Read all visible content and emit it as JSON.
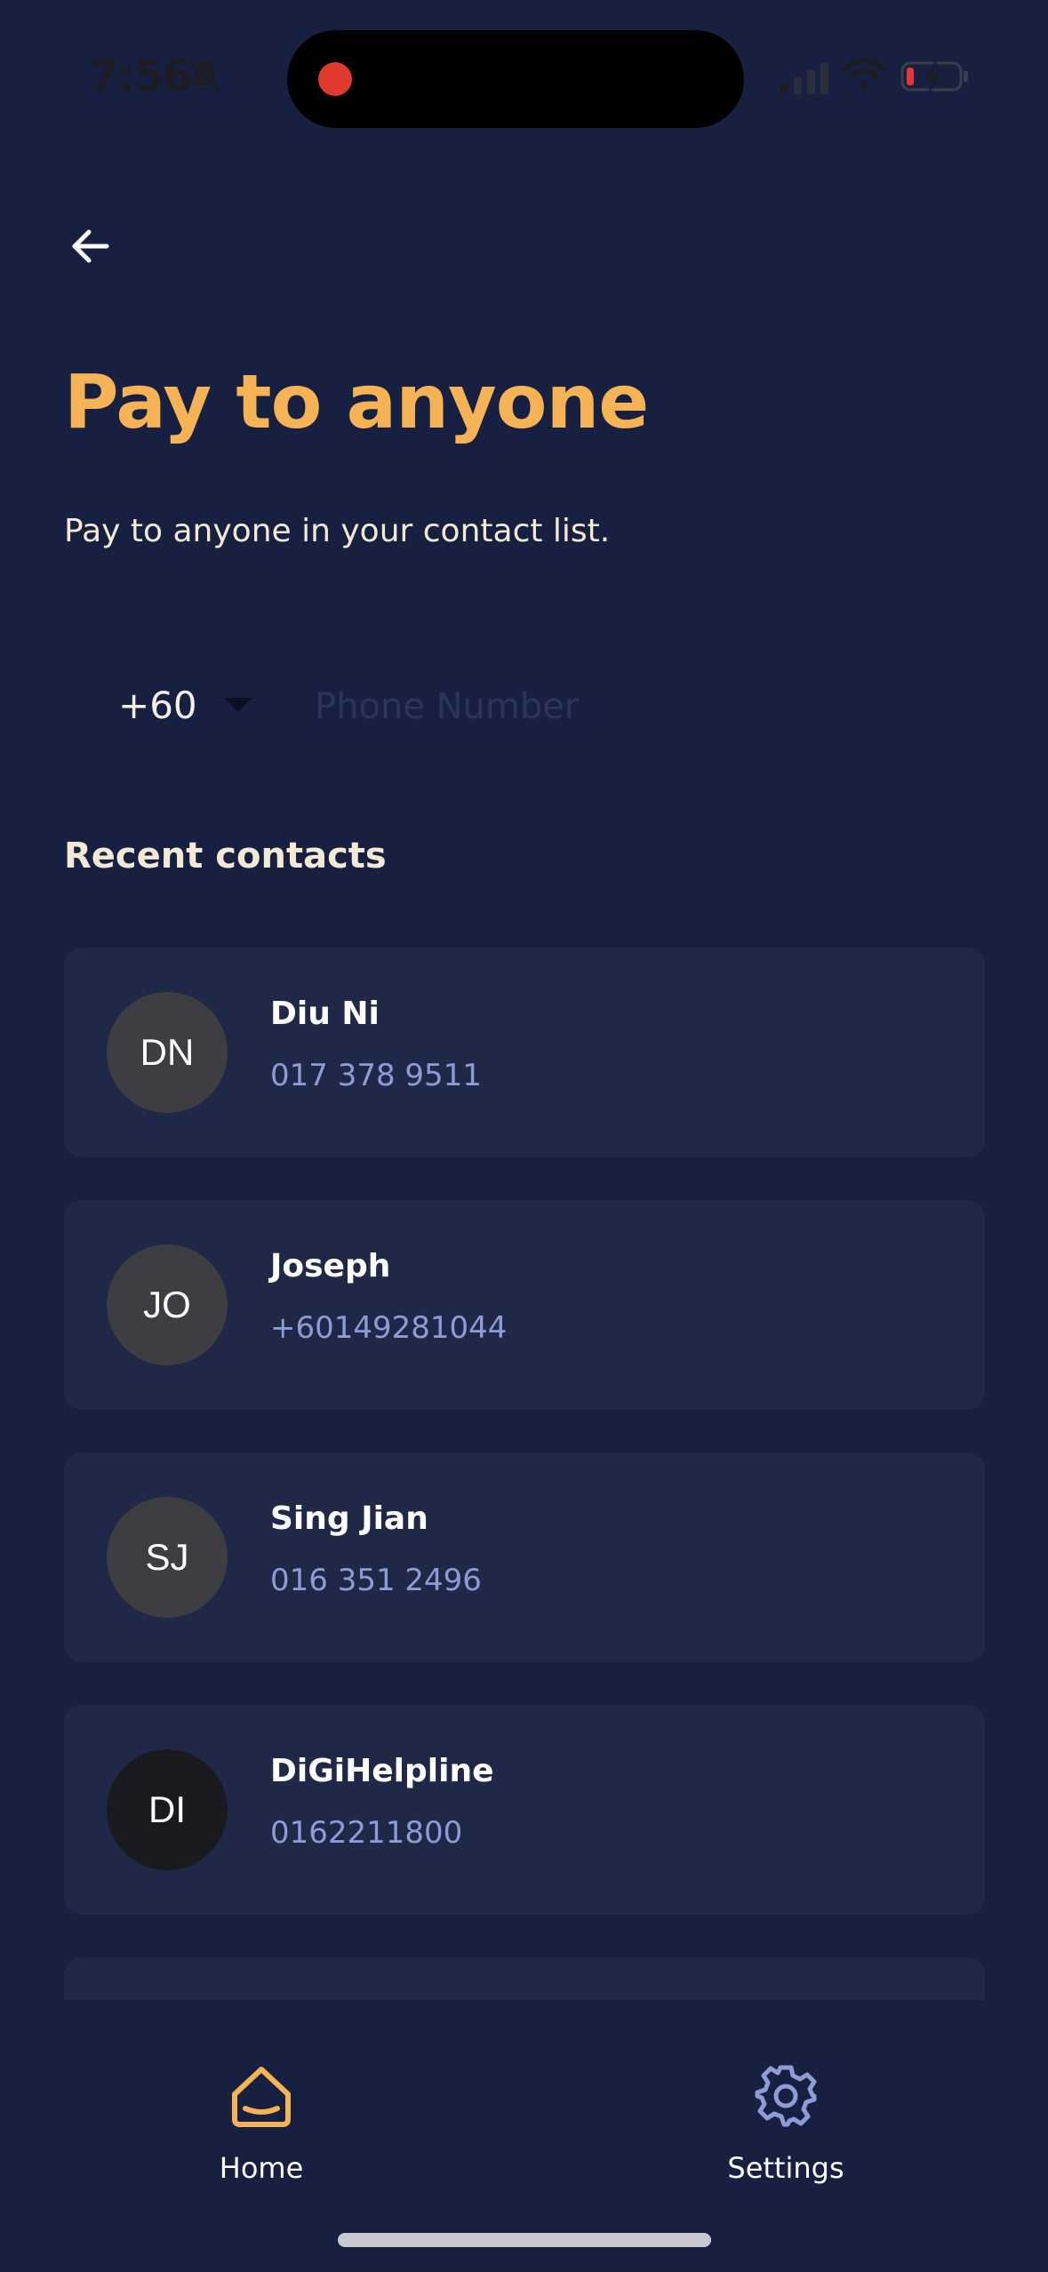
{
  "status_bar": {
    "time": "7:56"
  },
  "header": {
    "title": "Pay to anyone",
    "subtitle": "Pay to anyone in your contact list."
  },
  "phone_input": {
    "country_code": "+60",
    "placeholder": "Phone Number",
    "value": ""
  },
  "recent_contacts": {
    "heading": "Recent contacts",
    "items": [
      {
        "initials": "DN",
        "name": "Diu Ni",
        "phone": "017 378 9511"
      },
      {
        "initials": "JO",
        "name": "Joseph",
        "phone": "+60149281044"
      },
      {
        "initials": "SJ",
        "name": "Sing Jian",
        "phone": "016 351 2496"
      },
      {
        "initials": "DI",
        "name": "DiGiHelpline",
        "phone": "0162211800"
      }
    ]
  },
  "bottom_nav": {
    "home_label": "Home",
    "settings_label": "Settings"
  },
  "colors": {
    "background": "#172040",
    "card": "#1f2947",
    "accent": "#f6b356",
    "phone_text": "#8e9cd6",
    "settings_icon": "#8e9cd6"
  },
  "icons": {
    "back": "back-arrow-icon",
    "home": "home-icon",
    "settings": "gear-icon"
  }
}
